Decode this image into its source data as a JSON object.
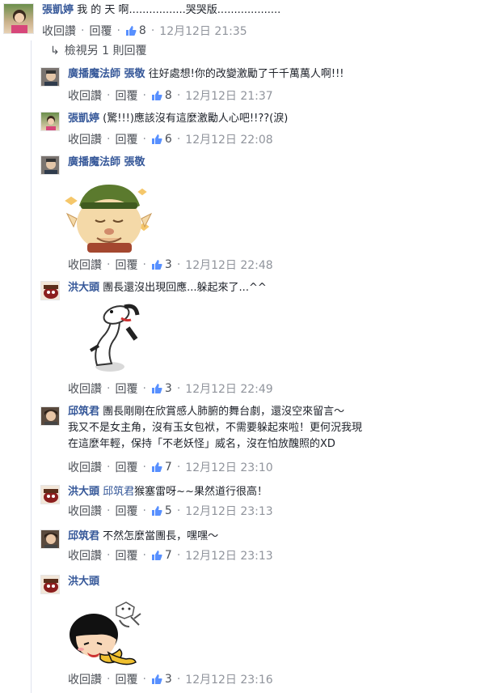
{
  "labels": {
    "reply_link": "收回讚",
    "reply_btn": "回覆",
    "dot": "·"
  },
  "top": {
    "name": "張凱婷",
    "text": "我 的 天 啊.................哭哭版...................",
    "likes": "8",
    "time": "12月12日 21:35"
  },
  "view_more": "檢視另 1 則回覆",
  "replies": [
    {
      "name": "廣播魔法師 張敬",
      "text": "往好處想!你的改變激勵了千千萬萬人啊!!!",
      "likes": "8",
      "time": "12月12日 21:37"
    },
    {
      "name": "張凱婷",
      "text": "(驚!!!)應該沒有這麼激勵人心吧!!??(淚)",
      "likes": "6",
      "time": "12月12日 22:08"
    },
    {
      "name": "廣播魔法師 張敬",
      "text": "",
      "likes": "3",
      "time": "12月12日 22:48"
    },
    {
      "name": "洪大頭",
      "text": "團長還沒出現回應...躲起來了...^^",
      "likes": "3",
      "time": "12月12日 22:49"
    },
    {
      "name": "邱筑君",
      "text_lines": [
        "團長剛剛在欣賞感人肺腑的舞台劇，還沒空來留言～",
        "我又不是女主角，沒有玉女包袱，不需要躲起來啦！更何況我現",
        "在這麼年輕，保持「不老妖怪」威名，沒在怕放醜照的XD"
      ],
      "likes": "7",
      "time": "12月12日 23:10"
    },
    {
      "name": "洪大頭",
      "mention": "邱筑君",
      "text": "猴塞雷呀~~果然道行很高！",
      "likes": "5",
      "time": "12月12日 23:13"
    },
    {
      "name": "邱筑君",
      "text": "不然怎麼當團長，嘿嘿～",
      "likes": "7",
      "time": "12月12日 23:13"
    },
    {
      "name": "洪大頭",
      "text": "",
      "likes": "3",
      "time": "12月12日 23:16"
    }
  ]
}
